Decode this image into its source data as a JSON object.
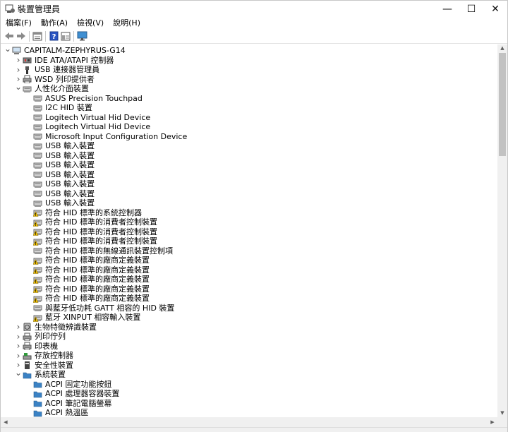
{
  "window": {
    "title": "裝置管理員",
    "controls": {
      "minimize": "—",
      "maximize": "☐",
      "close": "✕"
    }
  },
  "menu": [
    "檔案(F)",
    "動作(A)",
    "檢視(V)",
    "說明(H)"
  ],
  "toolbar": {
    "buttons": [
      "back-icon",
      "forward-icon",
      "properties-icon",
      "help-icon",
      "view-icon",
      "monitor-icon"
    ]
  },
  "tree": {
    "root": "CAPITALM-ZEPHYRUS-G14",
    "rows": [
      {
        "label": "CAPITALM-ZEPHYRUS-G14",
        "level": 0,
        "expander": "expanded",
        "icon": "computer-icon"
      },
      {
        "label": "IDE ATA/ATAPI 控制器",
        "level": 1,
        "expander": "collapsed",
        "icon": "ide-controller-icon"
      },
      {
        "label": "USB 連接器管理員",
        "level": 1,
        "expander": "collapsed",
        "icon": "usb-connector-icon"
      },
      {
        "label": "WSD 列印提供者",
        "level": 1,
        "expander": "collapsed",
        "icon": "printer-provider-icon"
      },
      {
        "label": "人性化介面裝置",
        "level": 1,
        "expander": "expanded",
        "icon": "hid-icon"
      },
      {
        "label": "ASUS Precision Touchpad",
        "level": 2,
        "icon": "hid-icon"
      },
      {
        "label": "I2C HID 裝置",
        "level": 2,
        "icon": "hid-icon"
      },
      {
        "label": "Logitech Virtual Hid Device",
        "level": 2,
        "icon": "hid-icon"
      },
      {
        "label": "Logitech Virtual Hid Device",
        "level": 2,
        "icon": "hid-icon"
      },
      {
        "label": "Microsoft Input Configuration Device",
        "level": 2,
        "icon": "hid-icon"
      },
      {
        "label": "USB 輸入裝置",
        "level": 2,
        "icon": "hid-icon"
      },
      {
        "label": "USB 輸入裝置",
        "level": 2,
        "icon": "hid-icon"
      },
      {
        "label": "USB 輸入裝置",
        "level": 2,
        "icon": "hid-icon"
      },
      {
        "label": "USB 輸入裝置",
        "level": 2,
        "icon": "hid-icon"
      },
      {
        "label": "USB 輸入裝置",
        "level": 2,
        "icon": "hid-icon"
      },
      {
        "label": "USB 輸入裝置",
        "level": 2,
        "icon": "hid-icon"
      },
      {
        "label": "USB 輸入裝置",
        "level": 2,
        "icon": "hid-icon"
      },
      {
        "label": "符合 HID 標準的系統控制器",
        "level": 2,
        "icon": "hid-warning-icon"
      },
      {
        "label": "符合 HID 標準的消費者控制裝置",
        "level": 2,
        "icon": "hid-warning-icon"
      },
      {
        "label": "符合 HID 標準的消費者控制裝置",
        "level": 2,
        "icon": "hid-warning-icon"
      },
      {
        "label": "符合 HID 標準的消費者控制裝置",
        "level": 2,
        "icon": "hid-warning-icon"
      },
      {
        "label": "符合 HID 標準的無線通訊裝置控制項",
        "level": 2,
        "icon": "hid-icon"
      },
      {
        "label": "符合 HID 標準的廠商定義裝置",
        "level": 2,
        "icon": "hid-warning-icon"
      },
      {
        "label": "符合 HID 標準的廠商定義裝置",
        "level": 2,
        "icon": "hid-warning-icon"
      },
      {
        "label": "符合 HID 標準的廠商定義裝置",
        "level": 2,
        "icon": "hid-warning-icon"
      },
      {
        "label": "符合 HID 標準的廠商定義裝置",
        "level": 2,
        "icon": "hid-warning-icon"
      },
      {
        "label": "符合 HID 標準的廠商定義裝置",
        "level": 2,
        "icon": "hid-warning-icon"
      },
      {
        "label": "與藍牙低功耗 GATT 相容的 HID 裝置",
        "level": 2,
        "icon": "hid-icon"
      },
      {
        "label": "藍牙 XINPUT 相容輸入裝置",
        "level": 2,
        "icon": "hid-warning-icon"
      },
      {
        "label": "生物特徵辨識裝置",
        "level": 1,
        "expander": "collapsed",
        "icon": "biometric-icon"
      },
      {
        "label": "列印佇列",
        "level": 1,
        "expander": "collapsed",
        "icon": "print-queue-icon"
      },
      {
        "label": "印表機",
        "level": 1,
        "expander": "collapsed",
        "icon": "printer-icon"
      },
      {
        "label": "存放控制器",
        "level": 1,
        "expander": "collapsed",
        "icon": "storage-controller-icon"
      },
      {
        "label": "安全性裝置",
        "level": 1,
        "expander": "collapsed",
        "icon": "security-device-icon"
      },
      {
        "label": "系統裝置",
        "level": 1,
        "expander": "expanded",
        "icon": "system-folder-icon"
      },
      {
        "label": "ACPI 固定功能按鈕",
        "level": 2,
        "icon": "system-folder-icon"
      },
      {
        "label": "ACPI 處理器容器裝置",
        "level": 2,
        "icon": "system-folder-icon"
      },
      {
        "label": "ACPI 筆記電腦螢幕",
        "level": 2,
        "icon": "system-folder-icon"
      },
      {
        "label": "ACPI 熱溫區",
        "level": 2,
        "icon": "system-folder-icon"
      }
    ]
  },
  "colors": {
    "warning": "#f2c200",
    "hid_gray": "#8c8c8c",
    "folder_blue": "#3b82c4"
  }
}
